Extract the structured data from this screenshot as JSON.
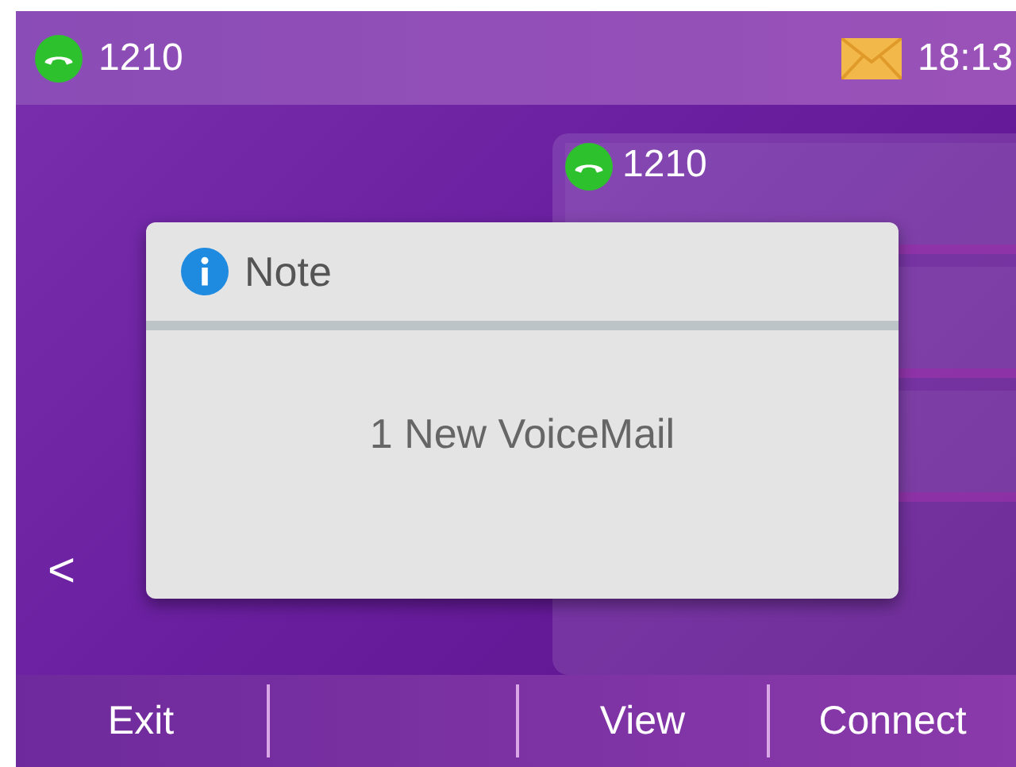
{
  "status_bar": {
    "account": "1210",
    "time": "18:13"
  },
  "line_keys": [
    {
      "kind": "account",
      "label": "1210"
    },
    {
      "kind": "blank"
    },
    {
      "kind": "blank"
    }
  ],
  "nav": {
    "back": "<"
  },
  "dialog": {
    "title": "Note",
    "message": "1 New VoiceMail"
  },
  "softkeys": [
    {
      "kind": "label",
      "label": "Exit"
    },
    {
      "kind": "blank"
    },
    {
      "kind": "label",
      "label": "View"
    },
    {
      "kind": "label",
      "label": "Connect"
    }
  ]
}
